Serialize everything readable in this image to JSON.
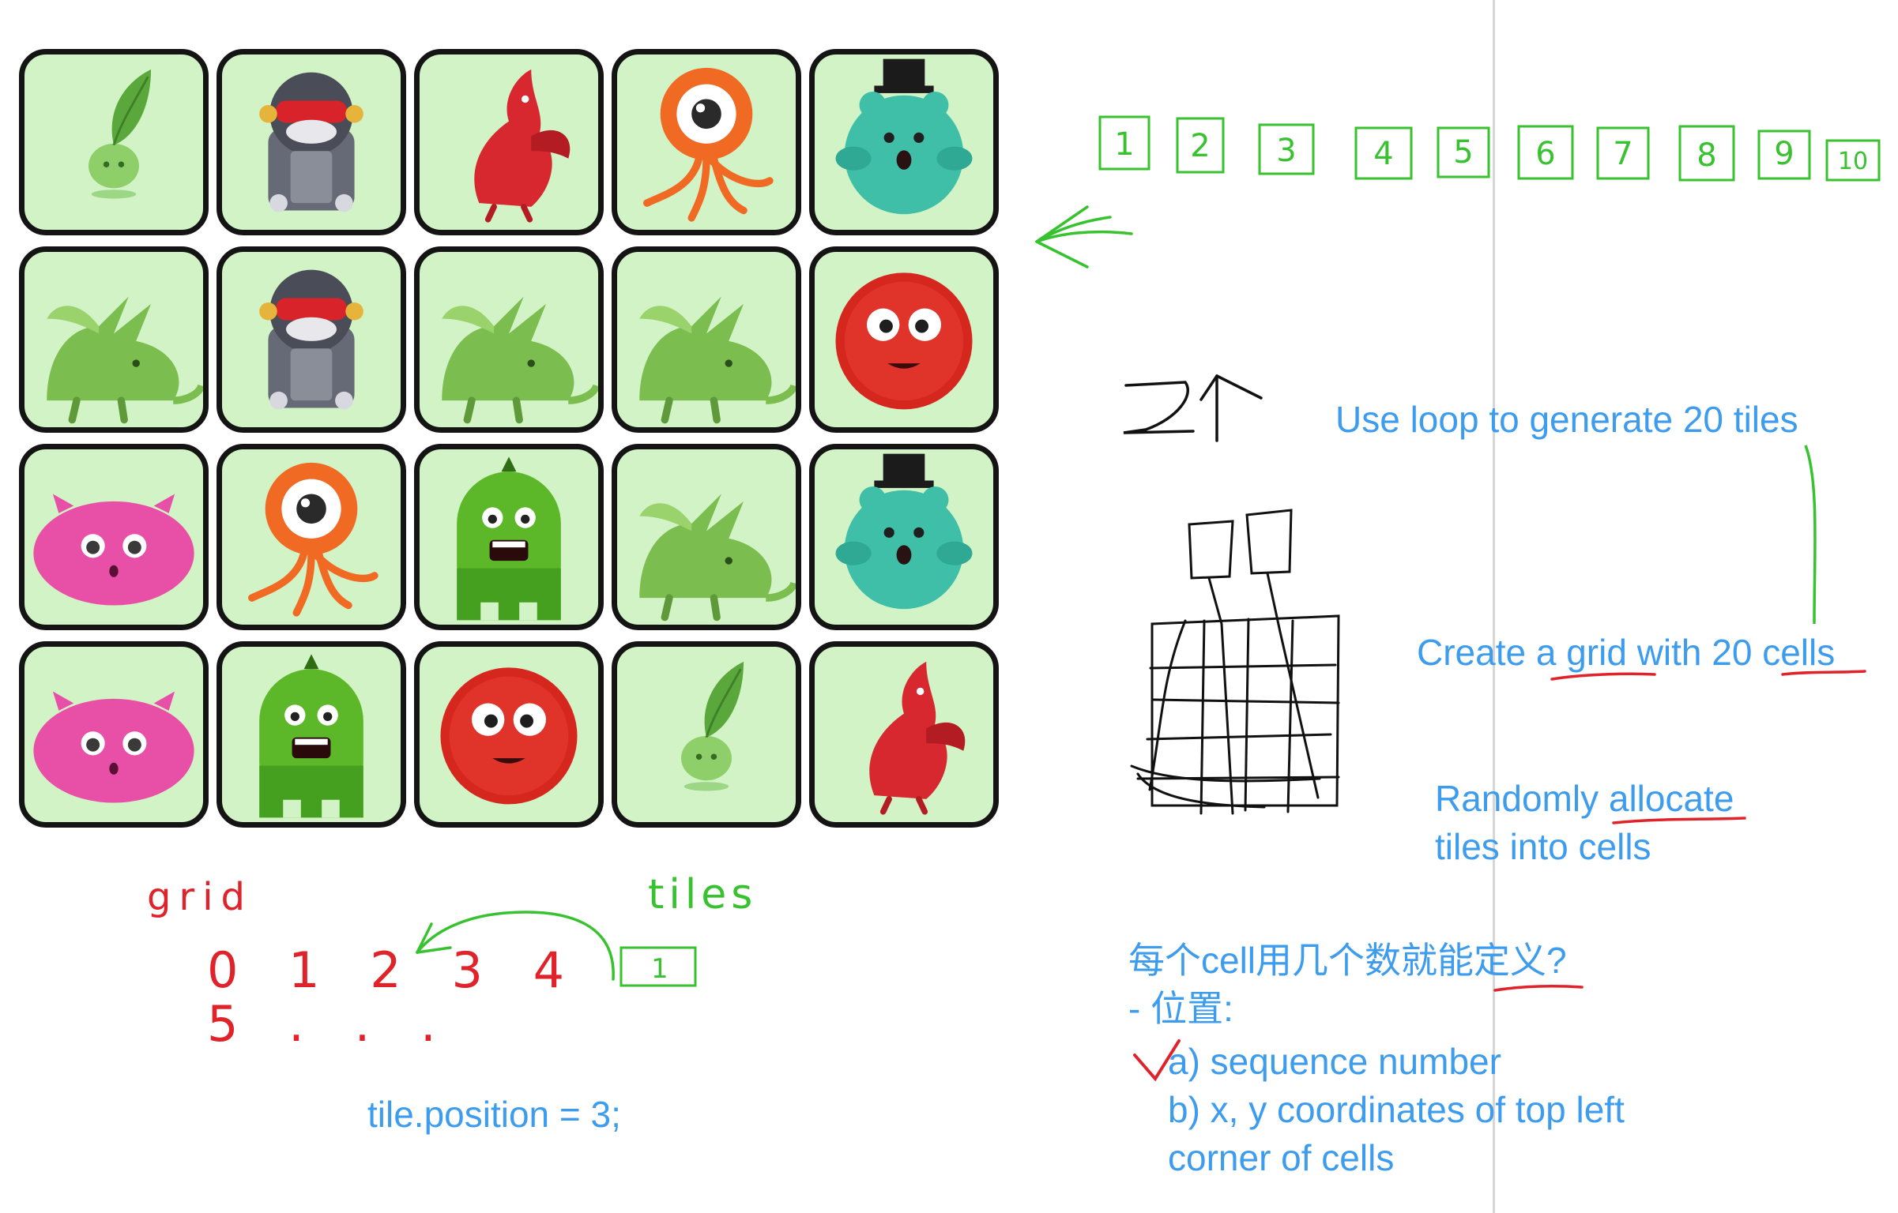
{
  "grid": {
    "tiles": [
      {
        "monster": "leaf-sprout"
      },
      {
        "monster": "robot-ninja"
      },
      {
        "monster": "red-dragon"
      },
      {
        "monster": "orange-eyeball"
      },
      {
        "monster": "teal-bear-top-hat"
      },
      {
        "monster": "green-dragon"
      },
      {
        "monster": "robot-ninja"
      },
      {
        "monster": "green-dragon"
      },
      {
        "monster": "green-dragon"
      },
      {
        "monster": "red-fuzzball"
      },
      {
        "monster": "pink-blob"
      },
      {
        "monster": "orange-eyeball"
      },
      {
        "monster": "green-pickle"
      },
      {
        "monster": "green-dragon"
      },
      {
        "monster": "teal-bear-top-hat"
      },
      {
        "monster": "pink-blob"
      },
      {
        "monster": "green-pickle"
      },
      {
        "monster": "red-fuzzball"
      },
      {
        "monster": "leaf-sprout"
      },
      {
        "monster": "red-dragon"
      }
    ]
  },
  "handwriting": {
    "number_row": [
      "1",
      "2",
      "3",
      "4",
      "5",
      "6",
      "7",
      "8",
      "9",
      "10"
    ],
    "grid_word": "grid",
    "tiles_word": "tiles",
    "seq_row1": "0 1 2 3 4",
    "seq_row2": "5 . . .",
    "tile_box_label": "1",
    "twenty": "20"
  },
  "notes": {
    "loop": "Use loop to generate 20 tiles",
    "grid": "Create a grid with 20 cells",
    "random_line1": "Randomly allocate",
    "random_line2": "tiles into cells",
    "question": "每个cell用几个数就能定义?",
    "position": "- 位置:",
    "option_a": "a) sequence number",
    "option_b_line1": "b) x, y coordinates of top left",
    "option_b_line2": "corner of cells",
    "code": "tile.position = 3;"
  },
  "colors": {
    "note_blue": "#3d9ced",
    "ink_green": "#38c230",
    "ink_red": "#e0232a",
    "ink_black": "#111111",
    "tile_bg": "#d2f3c6",
    "tile_border": "#141414"
  }
}
